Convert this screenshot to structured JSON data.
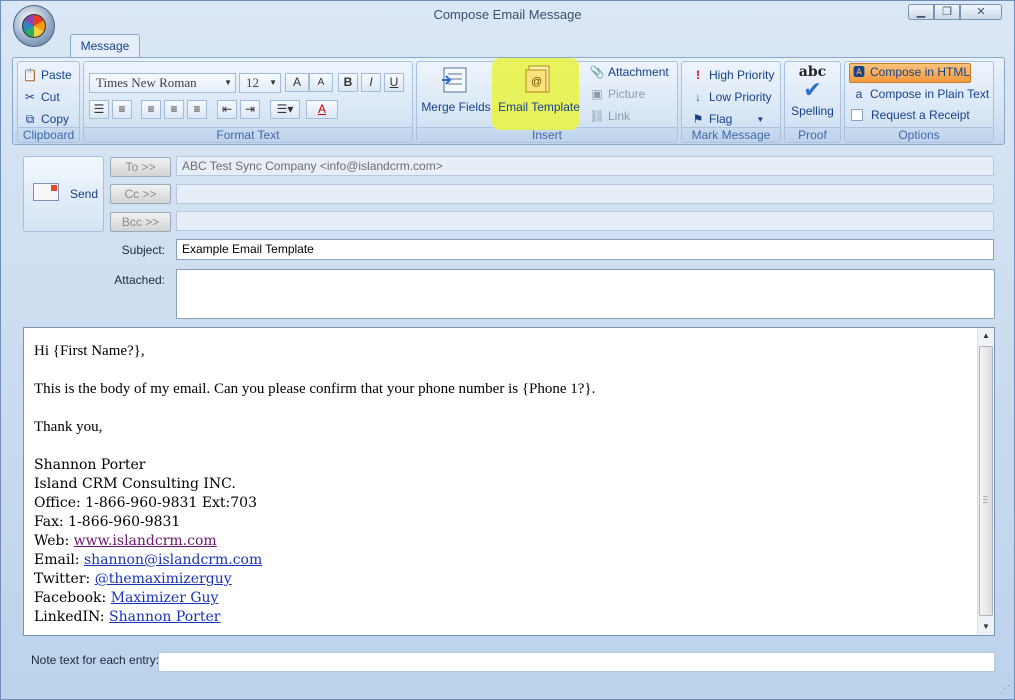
{
  "window": {
    "title": "Compose Email Message",
    "minimize": "▁",
    "restore": "❐",
    "close": "✕"
  },
  "ribbon": {
    "tab": "Message",
    "clipboard": {
      "label": "Clipboard",
      "paste": "Paste",
      "cut": "Cut",
      "copy": "Copy"
    },
    "format_text": {
      "label": "Format Text",
      "font": "Times New Roman",
      "size": "12",
      "grow": "A",
      "shrink": "A",
      "bold": "B",
      "italic": "I",
      "underline": "U",
      "font_color": "A"
    },
    "insert": {
      "label": "Insert",
      "merge_fields": "Merge Fields",
      "email_template": "Email Template",
      "attachment": "Attachment",
      "picture": "Picture",
      "link": "Link"
    },
    "mark_message": {
      "label": "Mark Message",
      "high_priority": "High Priority",
      "low_priority": "Low Priority",
      "flag": "Flag"
    },
    "proof": {
      "label": "Proof",
      "spelling": "Spelling",
      "abc": "abc"
    },
    "options": {
      "label": "Options",
      "compose_html": "Compose in HTML",
      "compose_plain": "Compose in Plain Text",
      "request_receipt": "Request a Receipt"
    }
  },
  "header": {
    "send": "Send",
    "to_btn": "To >>",
    "cc_btn": "Cc >>",
    "bcc_btn": "Bcc >>",
    "to_value": "ABC Test Sync Company <info@islandcrm.com>",
    "subject_label": "Subject:",
    "subject_value": "Example Email Template",
    "attached_label": "Attached:"
  },
  "body": {
    "greeting": "Hi {First Name?},",
    "line1": "This is the body of my email. Can you please confirm that your phone number is {Phone 1?}.",
    "closing": "Thank you,",
    "sig_name": "Shannon Porter",
    "sig_company": "Island CRM Consulting INC.",
    "sig_office": "Office: 1-866-960-9831 Ext:703",
    "sig_fax": "Fax: 1-866-960-9831",
    "web_label": "Web: ",
    "web_link": "www.islandcrm.com",
    "email_label": "Email: ",
    "email_link": "shannon@islandcrm.com",
    "twitter_label": "Twitter: ",
    "twitter_link": "@themaximizerguy",
    "facebook_label": "Facebook: ",
    "facebook_link": "Maximizer Guy",
    "linkedin_label": "LinkedIN: ",
    "linkedin_link": "Shannon Porter"
  },
  "footer": {
    "note_label": "Note text for each entry:"
  },
  "colors": {
    "highlight": "#e8f34a",
    "accent": "#15428b",
    "link": "#1a32b8"
  }
}
